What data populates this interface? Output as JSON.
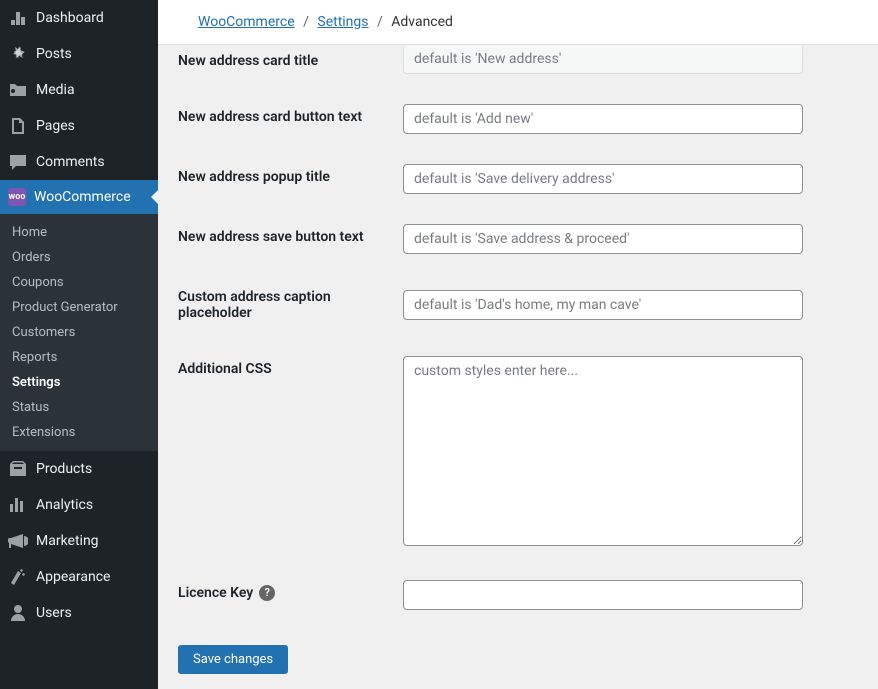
{
  "sidebar": {
    "main": [
      {
        "label": "Dashboard",
        "icon": "dashboard"
      },
      {
        "label": "Posts",
        "icon": "pin"
      },
      {
        "label": "Media",
        "icon": "media"
      },
      {
        "label": "Pages",
        "icon": "pages"
      },
      {
        "label": "Comments",
        "icon": "comments"
      }
    ],
    "woo_label": "WooCommerce",
    "woo_sub": [
      {
        "label": "Home"
      },
      {
        "label": "Orders"
      },
      {
        "label": "Coupons"
      },
      {
        "label": "Product Generator"
      },
      {
        "label": "Customers"
      },
      {
        "label": "Reports"
      },
      {
        "label": "Settings",
        "current": true
      },
      {
        "label": "Status"
      },
      {
        "label": "Extensions"
      }
    ],
    "bottom": [
      {
        "label": "Products",
        "icon": "products"
      },
      {
        "label": "Analytics",
        "icon": "analytics"
      },
      {
        "label": "Marketing",
        "icon": "marketing"
      },
      {
        "label": "Appearance",
        "icon": "appearance"
      },
      {
        "label": "Users",
        "icon": "users"
      }
    ]
  },
  "breadcrumb": {
    "a": "WooCommerce",
    "b": "Settings",
    "c": "Advanced"
  },
  "form": {
    "fields": [
      {
        "label": "New address card title",
        "placeholder": "default is 'New address'",
        "type": "text",
        "first": true
      },
      {
        "label": "New address card button text",
        "placeholder": "default is 'Add new'",
        "type": "text"
      },
      {
        "label": "New address popup title",
        "placeholder": "default is 'Save delivery address'",
        "type": "text"
      },
      {
        "label": "New address save button text",
        "placeholder": "default is 'Save address & proceed'",
        "type": "text"
      },
      {
        "label": "Custom address caption placeholder",
        "placeholder": "default is 'Dad's home, my man cave'",
        "type": "text"
      },
      {
        "label": "Additional CSS",
        "placeholder": "custom styles enter here...",
        "type": "textarea"
      },
      {
        "label": "Licence Key",
        "placeholder": "",
        "type": "text",
        "help": true
      }
    ],
    "save": "Save changes"
  }
}
